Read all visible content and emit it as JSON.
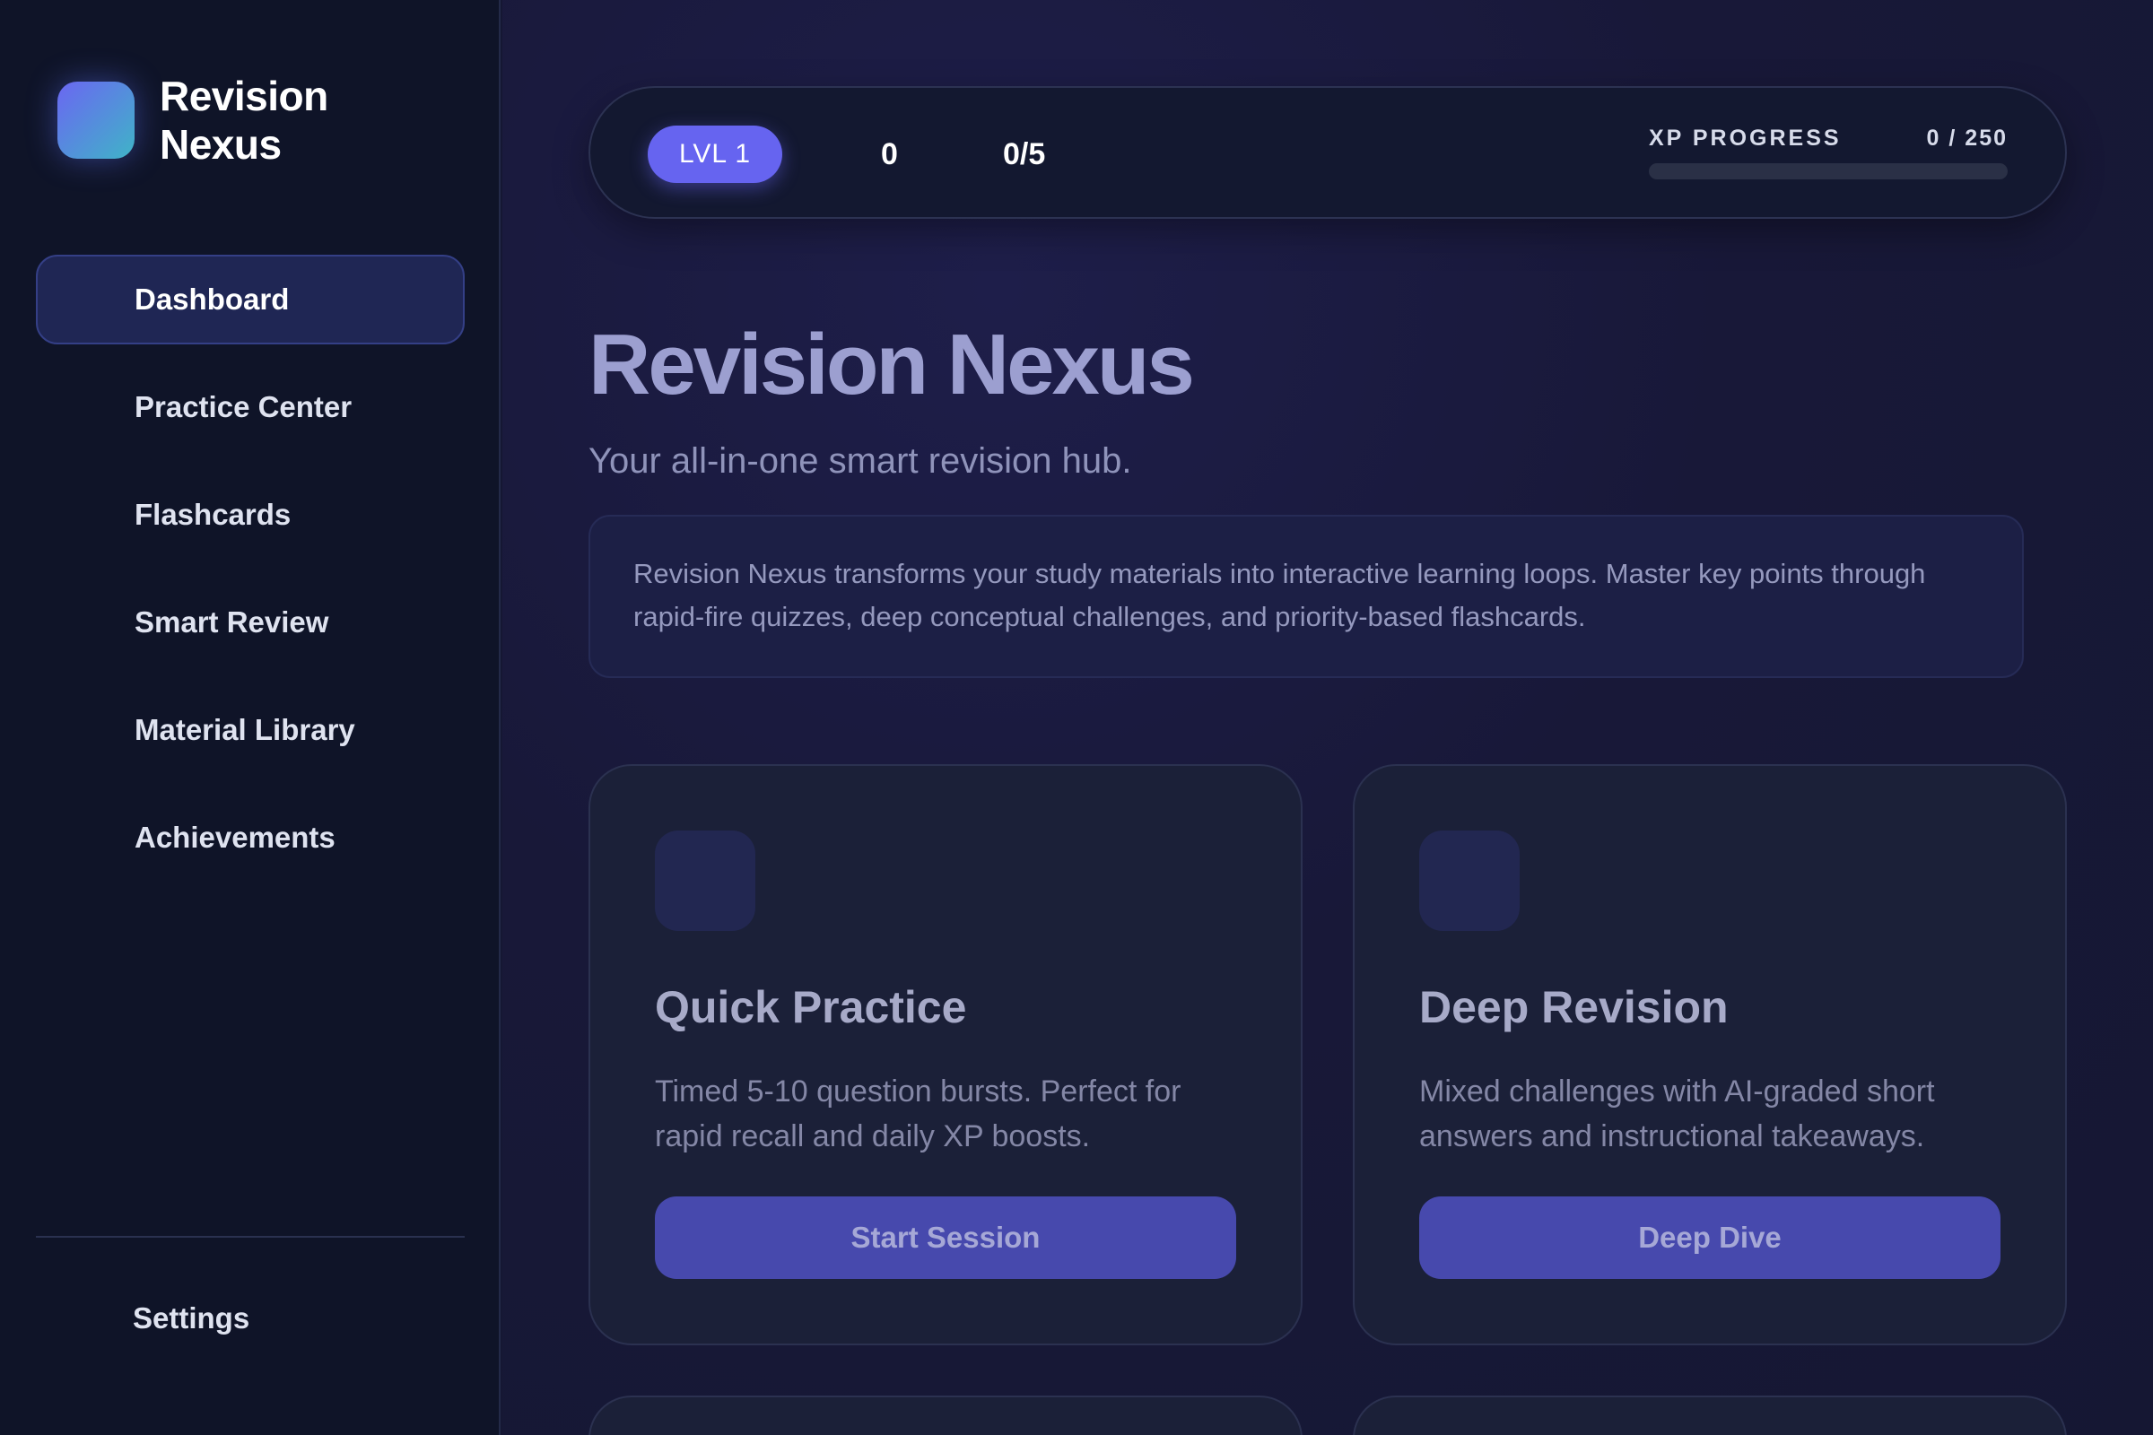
{
  "brand": {
    "name": "Revision Nexus"
  },
  "sidebar": {
    "items": [
      {
        "label": "Dashboard",
        "active": true
      },
      {
        "label": "Practice Center",
        "active": false
      },
      {
        "label": "Flashcards",
        "active": false
      },
      {
        "label": "Smart Review",
        "active": false
      },
      {
        "label": "Material Library",
        "active": false
      },
      {
        "label": "Achievements",
        "active": false
      }
    ],
    "settings_label": "Settings"
  },
  "topbar": {
    "level_label": "LVL 1",
    "score": "0",
    "goal": "0/5",
    "xp_label": "XP PROGRESS",
    "xp_value": "0 / 250",
    "xp_fraction": 0
  },
  "hero": {
    "title": "Revision Nexus",
    "subtitle": "Your all-in-one smart revision hub.",
    "intro": "Revision Nexus transforms your study materials into interactive learning loops. Master key points through rapid-fire quizzes, deep conceptual challenges, and priority-based flashcards."
  },
  "cards": [
    {
      "title": "Quick Practice",
      "description": "Timed 5-10 question bursts. Perfect for rapid recall and daily XP boosts.",
      "button_label": "Start Session"
    },
    {
      "title": "Deep Revision",
      "description": "Mixed challenges with AI-graded short answers and instructional takeaways.",
      "button_label": "Deep Dive"
    }
  ],
  "colors": {
    "accent": "#6664f0",
    "sidebar_bg": "#0f1428",
    "main_bg": "#151733",
    "button_bg": "#4749ad"
  }
}
